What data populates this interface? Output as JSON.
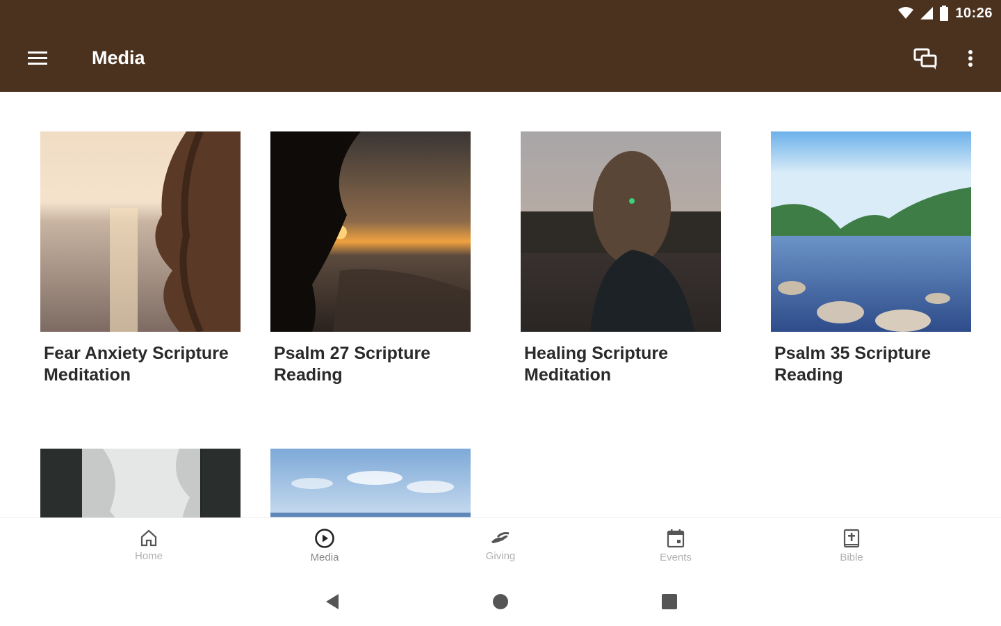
{
  "status_bar": {
    "time": "10:26"
  },
  "toolbar": {
    "menu_icon": "hamburger-menu-icon",
    "title": "Media",
    "chat_icon": "chat-bubbles-icon",
    "more_icon": "more-vert-icon"
  },
  "media_items": [
    {
      "title": "Fear Anxiety Scripture Meditation"
    },
    {
      "title": "Psalm 27 Scripture Reading"
    },
    {
      "title": "Healing Scripture Meditation"
    },
    {
      "title": "Psalm 35 Scripture Reading"
    },
    {
      "title": ""
    },
    {
      "title": ""
    }
  ],
  "bottom_nav": {
    "active": "Media",
    "items": [
      {
        "label": "Home",
        "icon": "home-icon"
      },
      {
        "label": "Media",
        "icon": "play-circle-icon"
      },
      {
        "label": "Giving",
        "icon": "giving-hand-icon"
      },
      {
        "label": "Events",
        "icon": "calendar-icon"
      },
      {
        "label": "Bible",
        "icon": "bible-icon"
      }
    ]
  },
  "colors": {
    "app_bar": "#4b321e",
    "background": "#ffffff",
    "nav_inactive": "#b0b0b0"
  }
}
